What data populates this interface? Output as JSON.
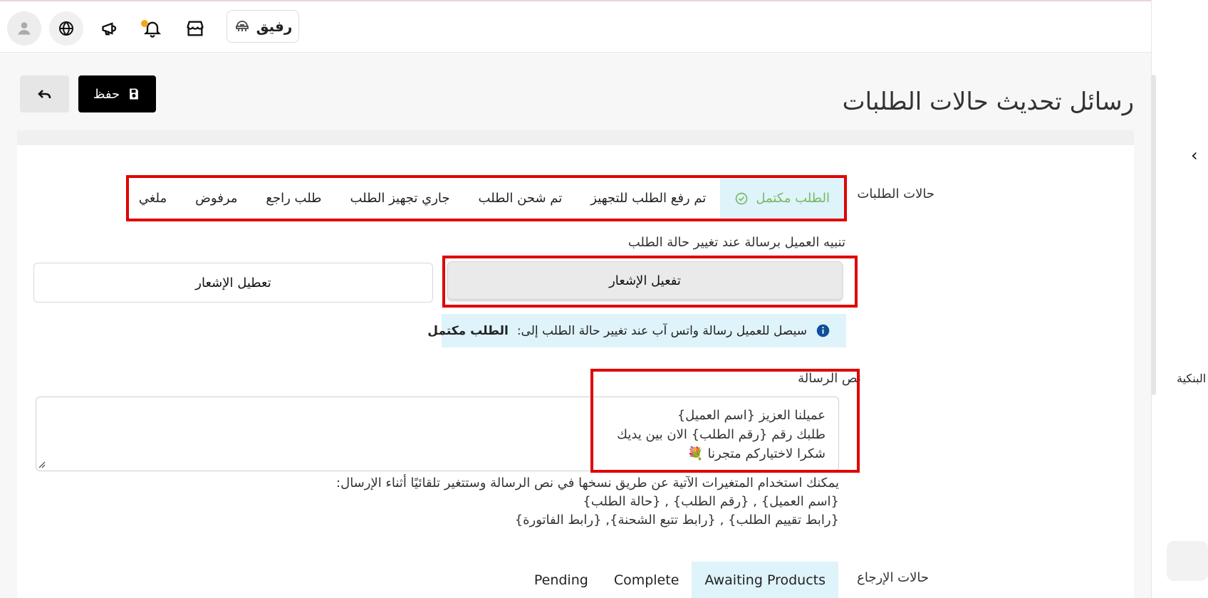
{
  "header": {
    "store_name": "رفيق",
    "page_title": "رسائل تحديث حالات الطلبات",
    "save_label": "حفظ"
  },
  "sidebar": {
    "partial_label": "البنكية"
  },
  "order_statuses": {
    "label": "حالات الطلبات",
    "tabs": [
      {
        "label": "الطلب مكتمل"
      },
      {
        "label": "تم رفع الطلب للتجهيز"
      },
      {
        "label": "تم شحن الطلب"
      },
      {
        "label": "جاري تجهيز الطلب"
      },
      {
        "label": "طلب راجع"
      },
      {
        "label": "مرفوض"
      },
      {
        "label": "ملغي"
      }
    ]
  },
  "notification": {
    "label": "تنبيه العميل برسالة عند تغيير حالة الطلب",
    "enable_label": "تفعيل الإشعار",
    "disable_label": "تعطيل الإشعار",
    "info_text": "سيصل للعميل رسالة واتس آب عند تغيير حالة الطلب إلى:",
    "info_status": "الطلب مكتمل"
  },
  "message": {
    "label": "نص الرسالة",
    "lines": [
      "عميلنا العزيز {اسم العميل}",
      "طلبك رقم {رقم الطلب} الان بين يديك",
      "شكرا لاختياركم متجرنا 💐"
    ]
  },
  "help": {
    "lines": [
      "يمكنك استخدام المتغيرات الآتية عن طريق نسخها في نص الرسالة وستتغير تلقائيًا أثناء الإرسال:",
      "{اسم العميل} , {رقم الطلب} , {حالة الطلب}",
      "{رابط تقييم الطلب} , {رابط تتبع الشحنة}, {رابط الفاتورة}"
    ]
  },
  "return_statuses": {
    "label": "حالات الإرجاع",
    "tabs": [
      {
        "label": "Awaiting Products"
      },
      {
        "label": "Complete"
      },
      {
        "label": "Pending"
      }
    ]
  },
  "colors": {
    "accent_highlight": "#e00000",
    "active_tab_bg": "#dff3fb",
    "active_tab_text": "#78b862",
    "notification_dot": "#f4a51c"
  }
}
